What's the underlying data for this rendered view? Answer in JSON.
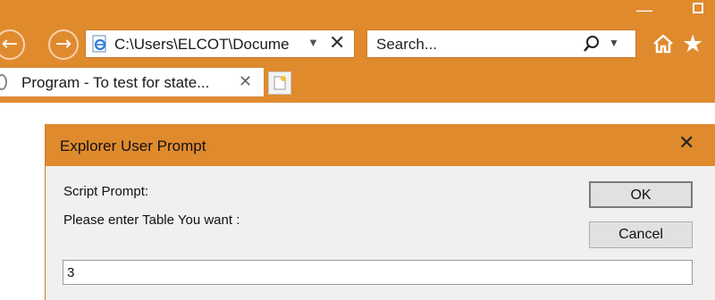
{
  "colors": {
    "chrome": "#e08a2e",
    "dialog_bg": "#f0f0f0"
  },
  "browser": {
    "address": {
      "text": "C:\\Users\\ELCOT\\Docume",
      "icon": "ie-page-icon"
    },
    "search": {
      "placeholder": "Search..."
    },
    "tab": {
      "title": "Program - To test for state..."
    },
    "icons": [
      "back-arrow-icon",
      "forward-arrow-icon",
      "close-icon",
      "search-icon",
      "home-icon",
      "favorites-star-icon",
      "new-tab-icon"
    ]
  },
  "dialog": {
    "title": "Explorer User Prompt",
    "label_script": "Script Prompt:",
    "label_message": "Please enter Table You want :",
    "ok_label": "OK",
    "cancel_label": "Cancel",
    "input_value": "3"
  }
}
